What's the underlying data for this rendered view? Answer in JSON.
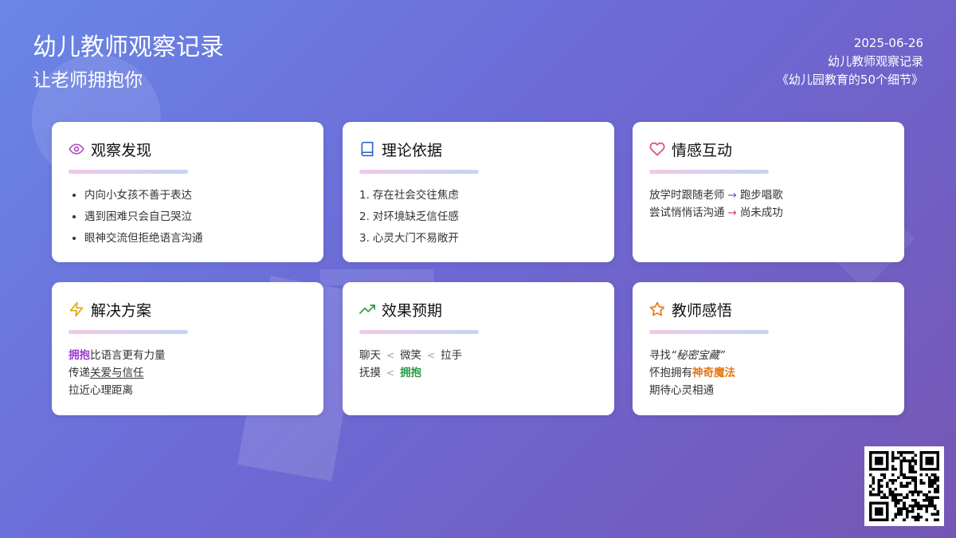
{
  "header": {
    "title": "幼儿教师观察记录",
    "subtitle": "让老师拥抱你",
    "date": "2025-06-26",
    "category": "幼儿教师观察记录",
    "source": "《幼儿园教育的50个细节》"
  },
  "cards": {
    "observe": {
      "icon": "eye-icon",
      "title": "观察发现",
      "items": [
        "内向小女孩不善于表达",
        "遇到困难只会自己哭泣",
        "眼神交流但拒绝语言沟通"
      ]
    },
    "theory": {
      "icon": "book-icon",
      "title": "理论依据",
      "items": [
        {
          "num": "1.",
          "text": "存在社会交往焦虑"
        },
        {
          "num": "2.",
          "text": "对环境缺乏信任感"
        },
        {
          "num": "3.",
          "text": "心灵大门不易敞开"
        }
      ]
    },
    "emotion": {
      "icon": "heart-icon",
      "title": "情感互动",
      "line1": {
        "a": "放学时跟随老师",
        "arrow": "→",
        "b": "跑步唱歌"
      },
      "line2": {
        "a": "尝试悄悄话沟通",
        "arrow": "→",
        "b": "尚未成功"
      }
    },
    "solution": {
      "icon": "lightning-icon",
      "title": "解决方案",
      "line1": {
        "highlight": "拥抱",
        "rest": "比语言更有力量"
      },
      "line2": {
        "pre": "传递",
        "underline": "关爱与信任"
      },
      "line3": "拉近心理距离"
    },
    "effect": {
      "icon": "trending-up-icon",
      "title": "效果预期",
      "line1": {
        "a": "聊天",
        "b": "微笑",
        "c": "拉手",
        "sep": "<"
      },
      "line2": {
        "a": "抚摸",
        "sep": "<",
        "b": "拥抱"
      }
    },
    "reflection": {
      "icon": "star-icon",
      "title": "教师感悟",
      "line1": {
        "pre": "寻找",
        "italic": "“秘密宝藏”"
      },
      "line2": {
        "pre": "怀抱拥有",
        "highlight": "神奇魔法"
      },
      "line3": "期待心灵相通"
    }
  },
  "qr": {
    "icon": "qr-code-icon"
  },
  "colors": {
    "bg_start": "#6a86e6",
    "bg_end": "#7556b4",
    "purple": "#9b3ccf",
    "green": "#2f9a4c",
    "orange": "#e67817",
    "icon_eye": "#b04fc0",
    "icon_book": "#3a63c8",
    "icon_heart": "#d64a86",
    "icon_bolt": "#e0a91a",
    "icon_trend": "#2f9a4c",
    "icon_star": "#e67817"
  }
}
